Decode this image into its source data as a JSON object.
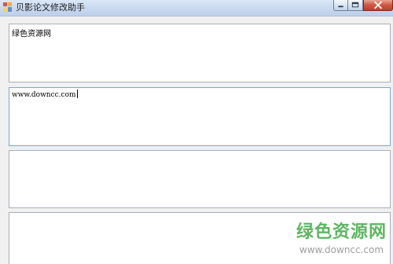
{
  "window": {
    "title": "贝影论文修改助手",
    "icon": "app-icon",
    "controls": {
      "minimize_icon": "minimize-icon",
      "maximize_icon": "maximize-icon",
      "close_icon": "close-icon"
    }
  },
  "textboxes": [
    {
      "value": "绿色资源网"
    },
    {
      "value": "www.downcc.com"
    },
    {
      "value": ""
    },
    {
      "value": ""
    }
  ],
  "watermark": {
    "title": "绿色资源网",
    "url": "www.downcc.com",
    "color": "#4caf50"
  }
}
